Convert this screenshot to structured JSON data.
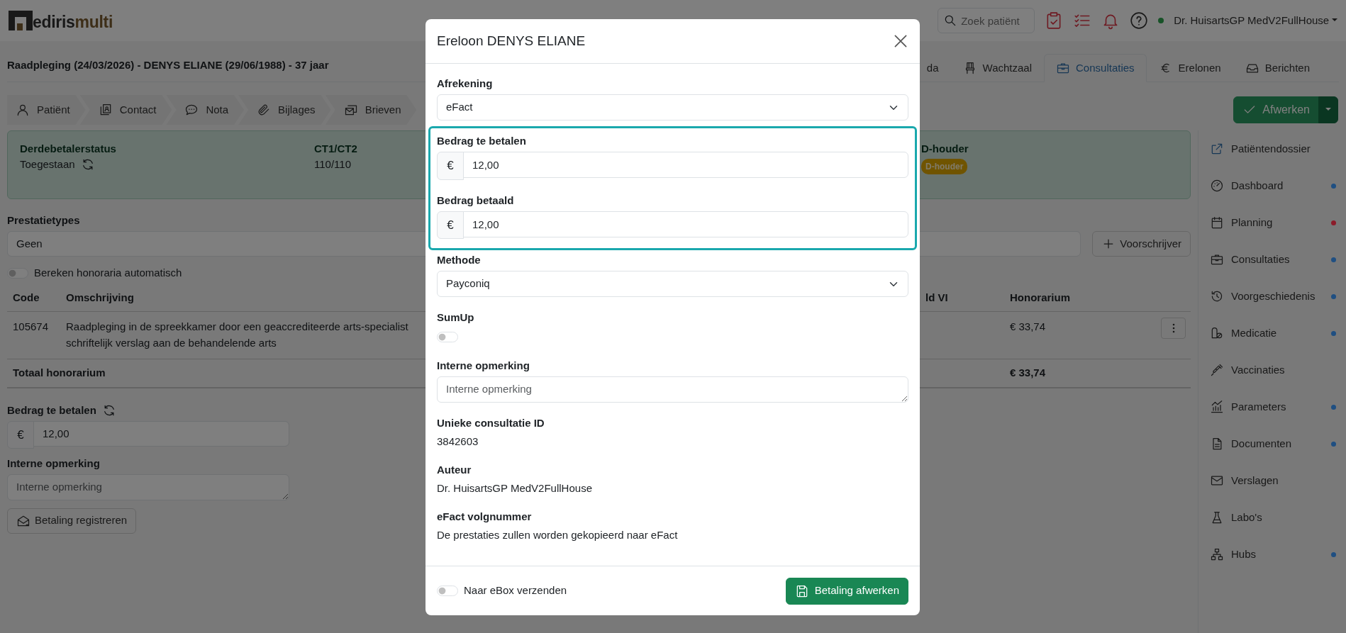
{
  "topbar": {
    "logo": {
      "part_1": "ediris",
      "part_2": "multi"
    },
    "search": {
      "placeholder": "Zoek patiënt"
    },
    "user": {
      "name": "Dr. HuisartsGP MedV2FullHouse",
      "online": true
    }
  },
  "page": {
    "title": "Raadpleging (24/03/2026) - DENYS ELIANE (29/06/1988) - 37 jaar",
    "tabs": [
      {
        "label": "da",
        "selected": false
      },
      {
        "label": "Wachtzaal",
        "selected": false
      },
      {
        "label": "Consultaties",
        "selected": true
      },
      {
        "label": "Erelonen",
        "selected": false
      },
      {
        "label": "Berichten",
        "selected": false
      }
    ],
    "steps": [
      "Patiënt",
      "Contact",
      "Nota",
      "Bijlages",
      "Brieven"
    ],
    "finish_button": "Afwerken"
  },
  "status_card": {
    "items": [
      {
        "kind": "refreshable",
        "label": "Derdebetalerstatus",
        "value": "Toegestaan"
      },
      {
        "kind": "text",
        "label": "CT1/CT2",
        "value": "110/110"
      },
      {
        "kind": "badge",
        "label": "D-houder",
        "value": "D-houder"
      }
    ]
  },
  "form": {
    "service_types": {
      "label": "Prestatietypes",
      "value": "Geen"
    },
    "prescriber_button": "Voorschrijver",
    "auto_calc": {
      "label": "Bereken honoraria automatisch",
      "on": false
    },
    "table": {
      "columns": [
        "Code",
        "Omschrijving",
        "ld VI",
        "Honorarium"
      ],
      "rows": [
        {
          "code": "105674",
          "description": "Raadpleging in de spreekkamer door een geaccrediteerde arts-specialist\nschriftelijk verslag aan de behandelende arts",
          "honorarium": "€ 33,74"
        }
      ],
      "total": {
        "label": "Totaal honorarium",
        "honorarium": "€ 33,74"
      }
    },
    "amount": {
      "label": "Bedrag te betalen",
      "prefix": "€",
      "value": "12,00"
    },
    "note": {
      "label": "Interne opmerking",
      "placeholder": "Interne opmerking"
    },
    "register_button": "Betaling registreren"
  },
  "sidebar": {
    "items": [
      {
        "label": "Patiëntendossier"
      },
      {
        "label": "Dashboard",
        "color": "#1f4f82"
      },
      {
        "label": "Planning",
        "color": "#8c1c2a"
      },
      {
        "label": "Consultaties",
        "color": "#1f4f82"
      },
      {
        "label": "Voorgeschiedenis",
        "color": "#1f4f82"
      },
      {
        "label": "Medicatie",
        "color": "#1f4f82"
      },
      {
        "label": "Vaccinaties"
      },
      {
        "label": "Parameters",
        "color": "#1f4f82"
      },
      {
        "label": "Documenten",
        "color": "#1f4f82"
      },
      {
        "label": "Verslagen"
      },
      {
        "label": "Labo's"
      },
      {
        "label": "Hubs",
        "color": "#1f4f82"
      }
    ]
  },
  "modal": {
    "title": "Ereloon DENYS ELIANE",
    "fields": [
      {
        "kind": "select",
        "label": "Afrekening",
        "value": "eFact"
      },
      {
        "kind": "group",
        "highlighted": true,
        "children": [
          {
            "kind": "money",
            "label": "Bedrag te betalen",
            "prefix": "€",
            "value": "12,00"
          },
          {
            "kind": "money",
            "label": "Bedrag betaald",
            "prefix": "€",
            "value": "12,00"
          }
        ]
      },
      {
        "kind": "select",
        "label": "Methode",
        "value": "Payconiq"
      },
      {
        "kind": "switch",
        "label": "SumUp",
        "on": false
      },
      {
        "kind": "textarea",
        "label": "Interne opmerking",
        "placeholder": "Interne opmerking"
      },
      {
        "kind": "static",
        "label": "Unieke consultatie ID",
        "value": "3842603"
      },
      {
        "kind": "static",
        "label": "Auteur",
        "value": "Dr. HuisartsGP MedV2FullHouse"
      },
      {
        "kind": "static",
        "label": "eFact volgnummer",
        "value": "De prestaties zullen worden gekopieerd naar eFact"
      }
    ],
    "footer": {
      "ebox": {
        "label": "Naar eBox verzenden",
        "on": false
      },
      "submit_button": "Betaling afwerken"
    }
  }
}
